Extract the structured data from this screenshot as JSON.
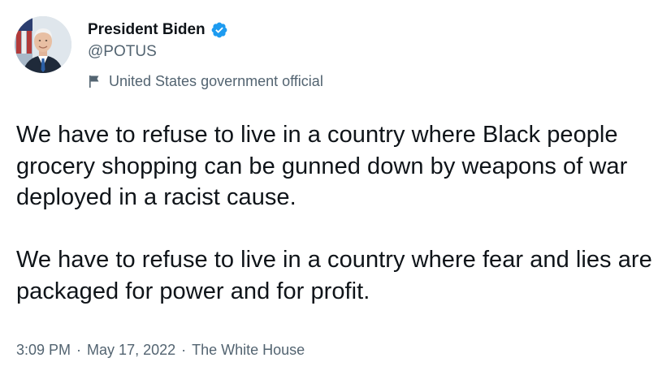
{
  "author": {
    "display_name": "President Biden",
    "handle": "@POTUS",
    "label": "United States government official",
    "verified_color": "#1d9bf0"
  },
  "tweet": {
    "paragraph_1": "We have to refuse to live in a country where Black people grocery shopping can be gunned down by weapons of war deployed in a racist cause.",
    "paragraph_2": "We have to refuse to live in a country where fear and lies are packaged for power and for profit."
  },
  "meta": {
    "time": "3:09 PM",
    "separator": "·",
    "date": "May 17, 2022",
    "source": "The White House"
  },
  "icons": {
    "verified": "verified-badge-icon",
    "label": "government-flag-icon",
    "avatar": "profile-photo"
  },
  "colors": {
    "text_primary": "#0f1419",
    "text_secondary": "#536471",
    "accent": "#1d9bf0"
  }
}
